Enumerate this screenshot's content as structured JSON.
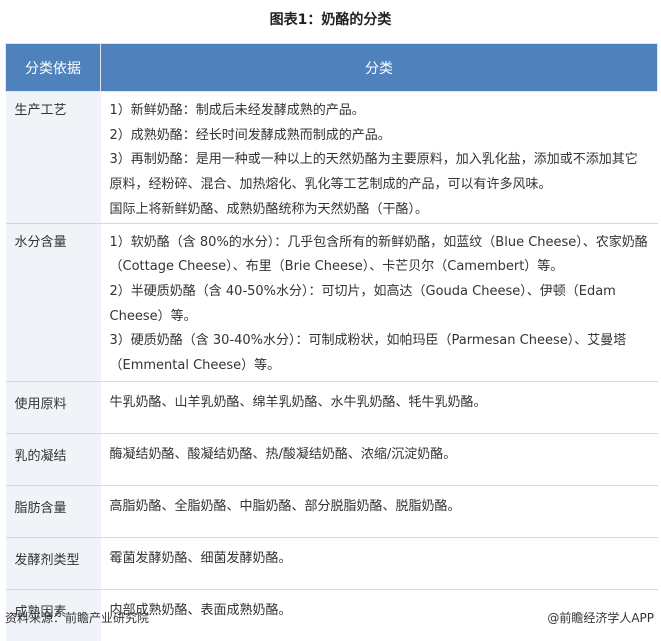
{
  "title": "图表1：奶酪的分类",
  "headers": {
    "col1": "分类依据",
    "col2": "分类"
  },
  "rows": [
    {
      "category": "生产工艺",
      "lines": [
        "1）新鲜奶酪：制成后未经发酵成熟的产品。",
        "2）成熟奶酪：经长时间发酵成熟而制成的产品。",
        "3）再制奶酪：是用一种或一种以上的天然奶酪为主要原料，加入乳化盐，添加或不添加其它原料，经粉碎、混合、加热熔化、乳化等工艺制成的产品，可以有许多风味。",
        "国际上将新鲜奶酪、成熟奶酪统称为天然奶酪（干酪）。"
      ]
    },
    {
      "category": "水分含量",
      "lines": [
        "1）软奶酪（含 80%的水分）：几乎包含所有的新鲜奶酪，如蓝纹（Blue Cheese）、农家奶酪（Cottage Cheese）、布里（Brie Cheese）、卡芒贝尔（Camembert）等。",
        "2）半硬质奶酪（含 40-50%水分）：可切片，如高达（Gouda Cheese）、伊顿（Edam Cheese）等。",
        "3）硬质奶酪（含 30-40%水分）：可制成粉状，如帕玛臣（Parmesan Cheese）、艾曼塔（Emmental Cheese）等。"
      ]
    },
    {
      "category": "使用原料",
      "lines": [
        "牛乳奶酪、山羊乳奶酪、绵羊乳奶酪、水牛乳奶酪、牦牛乳奶酪。"
      ]
    },
    {
      "category": "乳的凝结",
      "lines": [
        "酶凝结奶酪、酸凝结奶酪、热/酸凝结奶酪、浓缩/沉淀奶酪。"
      ]
    },
    {
      "category": "脂肪含量",
      "lines": [
        "高脂奶酪、全脂奶酪、中脂奶酪、部分脱脂奶酪、脱脂奶酪。"
      ]
    },
    {
      "category": "发酵剂类型",
      "lines": [
        "霉菌发酵奶酪、细菌发酵奶酪。"
      ]
    },
    {
      "category": "成熟因素",
      "lines": [
        "内部成熟奶酪、表面成熟奶酪。"
      ]
    }
  ],
  "source": "资料来源：前瞻产业研究院",
  "brand": "@前瞻经济学人APP"
}
